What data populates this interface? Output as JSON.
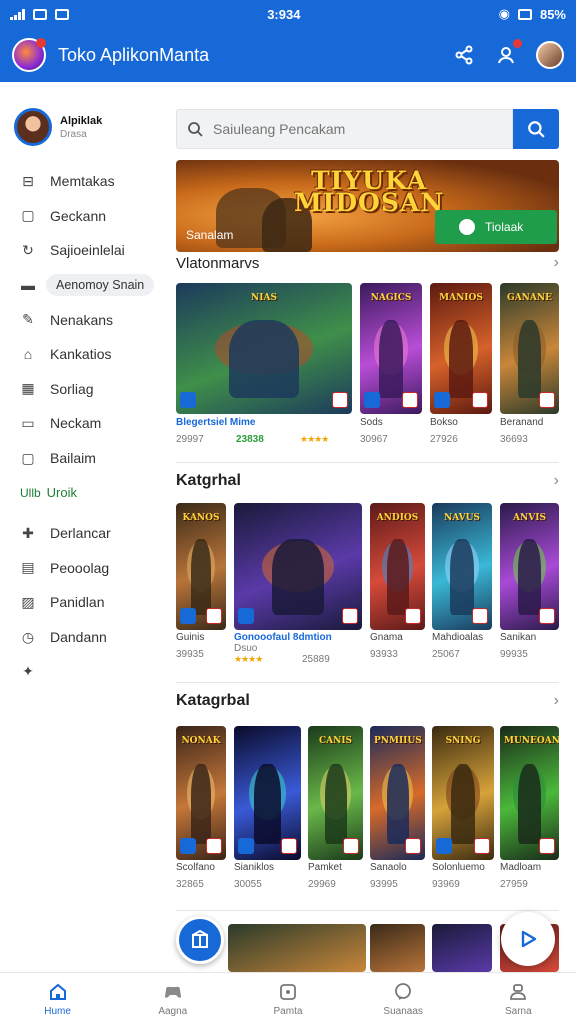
{
  "status_bar": {
    "time": "3:934",
    "battery": "85%"
  },
  "app": {
    "title": "Toko AplikonManta"
  },
  "profile": {
    "name": "Alpiklak",
    "subtitle": "Drasa"
  },
  "sidebar": {
    "items": [
      {
        "label": "Memtakas",
        "icon": "gamepad-icon"
      },
      {
        "label": "Geckann",
        "icon": "square-icon"
      },
      {
        "label": "Sajioeinlelai",
        "icon": "refresh-icon"
      },
      {
        "label": "Aenomoy Snain",
        "icon": "briefcase-icon",
        "active": true
      },
      {
        "label": "Nenakans",
        "icon": "pencil-icon"
      },
      {
        "label": "Kankatios",
        "icon": "home-icon"
      },
      {
        "label": "Sorliag",
        "icon": "grid-icon"
      },
      {
        "label": "Neckam",
        "icon": "page-icon"
      },
      {
        "label": "Bailaim",
        "icon": "frame-icon"
      },
      {
        "label": "Uroik",
        "icon": "chart-icon",
        "green": true,
        "prefix": "Ullb"
      },
      {
        "label": "Derlancar",
        "icon": "pin-icon"
      },
      {
        "label": "Peooolag",
        "icon": "doc-icon"
      },
      {
        "label": "Panidlan",
        "icon": "image-icon"
      },
      {
        "label": "Dandann",
        "icon": "clock-icon"
      },
      {
        "label": "",
        "icon": "puzzle-icon"
      }
    ]
  },
  "search": {
    "placeholder": "Saiuleang Pencakam"
  },
  "banner": {
    "title_line1": "TIYUKA",
    "title_line2": "MIDOSAN",
    "tag": "Sanalam",
    "cta": "Tiolaak"
  },
  "sections": [
    {
      "title": "Vlatonmarvs",
      "cards": [
        {
          "title": "NIAS",
          "label": "Blegertsiel Mime",
          "label_style": "blue",
          "count": "29997",
          "count2": "23838",
          "rating": "★★★★"
        },
        {
          "title": "NAGICS",
          "label": "Sods",
          "count": "30967"
        },
        {
          "title": "MANIOS",
          "label": "Bokso",
          "count": "27926"
        },
        {
          "title": "GANANE",
          "label": "Beranand",
          "count": "36693"
        }
      ]
    },
    {
      "title": "Katgrhal",
      "cards": [
        {
          "title": "KANOS",
          "label": "Guinis",
          "count": "39935"
        },
        {
          "title": "",
          "label": "Gonooofaul 8dmtion",
          "label_style": "blue",
          "sub": "Dsuo",
          "rating": "★★★★",
          "count": "25889"
        },
        {
          "title": "ANDIOS",
          "label": "Gnama",
          "count": "93933"
        },
        {
          "title": "NAVUS",
          "label": "Mahdioalas",
          "count": "25067"
        },
        {
          "title": "ANVIS",
          "label": "Sanikan",
          "count": "99935"
        }
      ]
    },
    {
      "title": "Katagrbal",
      "cards": [
        {
          "title": "NONAK",
          "label": "Scolfano",
          "count": "32865"
        },
        {
          "title": "",
          "label": "Sianiklos",
          "count": "30055"
        },
        {
          "title": "CANIS",
          "label": "Pamket",
          "count": "29969"
        },
        {
          "title": "PNMIIUS",
          "label": "Sanaolo",
          "count": "93995"
        },
        {
          "title": "SNING",
          "label": "Solonluemo",
          "count": "93969"
        },
        {
          "title": "MUNEOAN",
          "label": "Madloam",
          "count": "27959"
        }
      ]
    }
  ],
  "bottom_nav": [
    {
      "label": "Hume",
      "icon": "home-icon",
      "active": true
    },
    {
      "label": "Aagna",
      "icon": "controller-icon"
    },
    {
      "label": "Pamta",
      "icon": "apps-icon"
    },
    {
      "label": "Suanaas",
      "icon": "chat-icon"
    },
    {
      "label": "Sarna",
      "icon": "person-icon"
    }
  ],
  "colors": {
    "primary": "#1769d8",
    "accent_green": "#1f9d4a",
    "star": "#f2a600"
  }
}
